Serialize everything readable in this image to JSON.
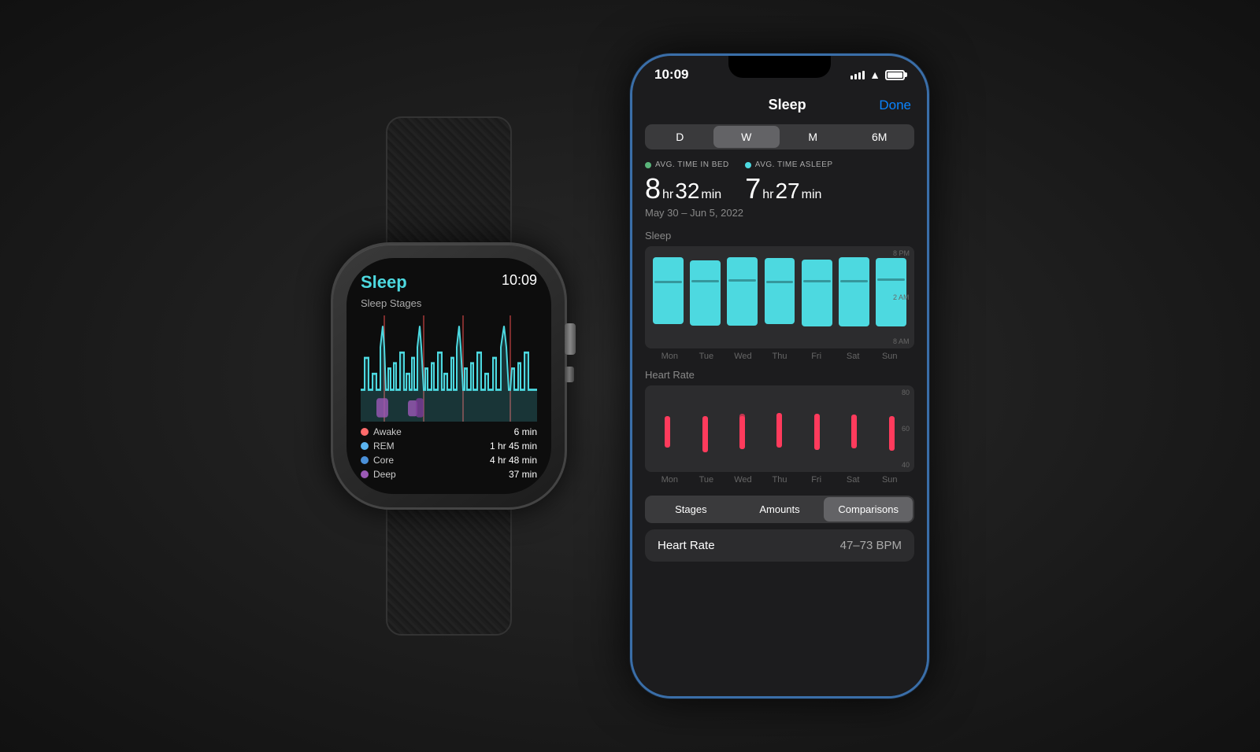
{
  "background_color": "#1a1a1a",
  "watch": {
    "title": "Sleep",
    "time": "10:09",
    "subtitle": "Sleep Stages",
    "legend": [
      {
        "label": "Awake",
        "value": "6 min",
        "color": "#ff6b6b"
      },
      {
        "label": "REM",
        "value": "1 hr 45 min",
        "color": "#5ab4f0"
      },
      {
        "label": "Core",
        "value": "4 hr 48 min",
        "color": "#4a90d9"
      },
      {
        "label": "Deep",
        "value": "37 min",
        "color": "#9b59b6"
      }
    ]
  },
  "phone": {
    "status_bar": {
      "time": "10:09",
      "signal": "●●●●",
      "wifi": "wifi",
      "battery": "battery"
    },
    "header": {
      "title": "Sleep",
      "done_label": "Done"
    },
    "segments": [
      {
        "label": "D",
        "active": false
      },
      {
        "label": "W",
        "active": true
      },
      {
        "label": "M",
        "active": false
      },
      {
        "label": "6M",
        "active": false
      }
    ],
    "stats": {
      "bed_legend": "AVG. TIME IN BED",
      "sleep_legend": "AVG. TIME ASLEEP",
      "bed_hours": "8",
      "bed_unit_hr": "hr",
      "bed_mins": "32",
      "bed_unit_min": "min",
      "sleep_hours": "7",
      "sleep_unit_hr": "hr",
      "sleep_mins": "27",
      "sleep_unit_min": "min",
      "date_range": "May 30 – Jun 5, 2022",
      "bed_color": "#5ab47a",
      "sleep_color": "#4dd9e0"
    },
    "sleep_chart": {
      "label": "Sleep",
      "y_labels": [
        "8 PM",
        "2 AM",
        "8 AM"
      ],
      "days": [
        "Mon",
        "Tue",
        "Wed",
        "Thu",
        "Fri",
        "Sat",
        "Sun"
      ],
      "bars": [
        {
          "top_pct": 5,
          "height_pct": 75
        },
        {
          "top_pct": 8,
          "height_pct": 70
        },
        {
          "top_pct": 5,
          "height_pct": 72
        },
        {
          "top_pct": 6,
          "height_pct": 73
        },
        {
          "top_pct": 7,
          "height_pct": 71
        },
        {
          "top_pct": 5,
          "height_pct": 74
        },
        {
          "top_pct": 6,
          "height_pct": 72
        }
      ]
    },
    "heart_chart": {
      "label": "Heart Rate",
      "y_labels": [
        "80",
        "60",
        "40"
      ],
      "days": [
        "Mon",
        "Tue",
        "Wed",
        "Thu",
        "Fri",
        "Sat",
        "Sun"
      ],
      "bars": [
        {
          "bottom_pct": 30,
          "height_pct": 40
        },
        {
          "bottom_pct": 25,
          "height_pct": 45
        },
        {
          "bottom_pct": 28,
          "height_pct": 42
        },
        {
          "bottom_pct": 30,
          "height_pct": 44
        },
        {
          "bottom_pct": 27,
          "height_pct": 46
        },
        {
          "bottom_pct": 29,
          "height_pct": 43
        },
        {
          "bottom_pct": 26,
          "height_pct": 44
        }
      ]
    },
    "bottom_segments": [
      {
        "label": "Stages",
        "active": false
      },
      {
        "label": "Amounts",
        "active": false
      },
      {
        "label": "Comparisons",
        "active": true
      }
    ],
    "heart_rate_row": {
      "label": "Heart Rate",
      "value": "47–73 BPM"
    }
  }
}
